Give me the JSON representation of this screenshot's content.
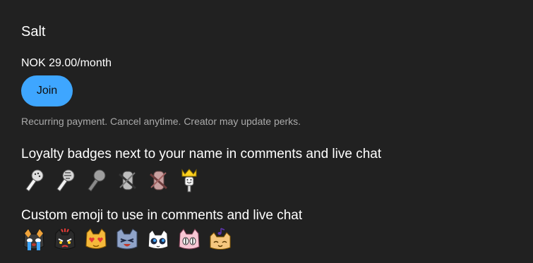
{
  "tier": {
    "name": "Salt",
    "price": "NOK 29.00/month",
    "join_label": "Join",
    "disclaimer": "Recurring payment. Cancel anytime. Creator may update perks."
  },
  "perks": {
    "badges_title": "Loyalty badges next to your name in comments and live chat",
    "badges": [
      {
        "icon": "salt-shaker-badge-icon"
      },
      {
        "icon": "salt-shaker-motion-badge-icon"
      },
      {
        "icon": "dark-salt-shaker-badge-icon"
      },
      {
        "icon": "crossed-salt-badge-icon"
      },
      {
        "icon": "pink-crossed-salt-badge-icon"
      },
      {
        "icon": "crowned-salt-badge-icon"
      }
    ],
    "emoji_title": "Custom emoji to use in comments and live chat",
    "emoji": [
      {
        "icon": "crying-cat-emoji-icon"
      },
      {
        "icon": "angry-cat-emoji-icon"
      },
      {
        "icon": "heart-eyes-cat-emoji-icon"
      },
      {
        "icon": "laughing-cat-emoji-icon"
      },
      {
        "icon": "wide-eyed-cat-emoji-icon"
      },
      {
        "icon": "pink-cat-emoji-icon"
      },
      {
        "icon": "singing-cat-emoji-icon"
      }
    ]
  },
  "colors": {
    "background": "#212121",
    "accent": "#3ea6ff",
    "secondary_text": "#aaaaaa"
  }
}
